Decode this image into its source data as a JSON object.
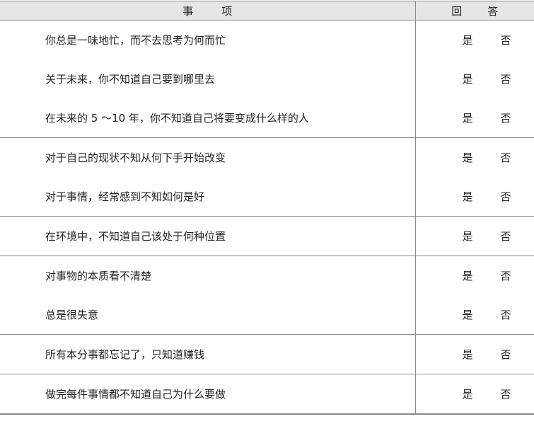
{
  "header": {
    "item_col_1": "事",
    "item_col_2": "项",
    "answer_col_1": "回",
    "answer_col_2": "答"
  },
  "rows": [
    {
      "text": "你总是一味地忙，而不去思考为何而忙",
      "yes": "是",
      "no": "否"
    },
    {
      "text": "关于未来，你不知道自己要到哪里去",
      "yes": "是",
      "no": "否"
    },
    {
      "text": "在未来的 5 ～10 年，你不知道自己将要变成什么样的人",
      "yes": "是",
      "no": "否"
    },
    {
      "text": "对于自己的现状不知从何下手开始改变",
      "yes": "是",
      "no": "否"
    },
    {
      "text": "对于事情，经常感到不知如何是好",
      "yes": "是",
      "no": "否"
    },
    {
      "text": "在环境中，不知道自己该处于何种位置",
      "yes": "是",
      "no": "否"
    },
    {
      "text": "对事物的本质看不清楚",
      "yes": "是",
      "no": "否"
    },
    {
      "text": "总是很失意",
      "yes": "是",
      "no": "否"
    },
    {
      "text": "所有本分事都忘记了，只知道赚钱",
      "yes": "是",
      "no": "否"
    },
    {
      "text": "做完每件事情都不知道自己为什么要做",
      "yes": "是",
      "no": "否"
    }
  ]
}
